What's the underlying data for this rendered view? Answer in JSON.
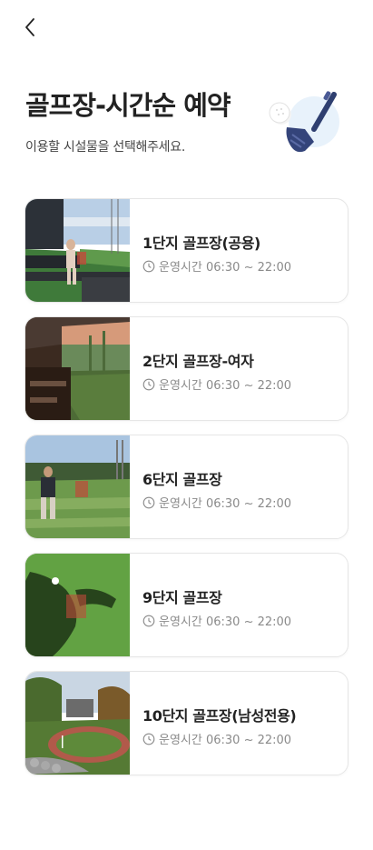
{
  "header": {
    "back_icon": "chevron-left-icon",
    "title": "골프장-시간순 예약",
    "subtitle": "이용할 시설물을 선택해주세요."
  },
  "hero_icon": "golf-club-ball-icon",
  "facilities": [
    {
      "name": "1단지 골프장(공용)",
      "hours": "운영시간 06:30 ~ 22:00"
    },
    {
      "name": "2단지 골프장-여자",
      "hours": "운영시간 06:30 ~ 22:00"
    },
    {
      "name": "6단지 골프장",
      "hours": "운영시간 06:30 ~ 22:00"
    },
    {
      "name": "9단지 골프장",
      "hours": "운영시간 06:30 ~ 22:00"
    },
    {
      "name": "10단지 골프장(남성전용)",
      "hours": "운영시간 06:30 ~ 22:00"
    }
  ],
  "colors": {
    "accent": "#3a4a7a",
    "muted": "#8a8a8a"
  }
}
